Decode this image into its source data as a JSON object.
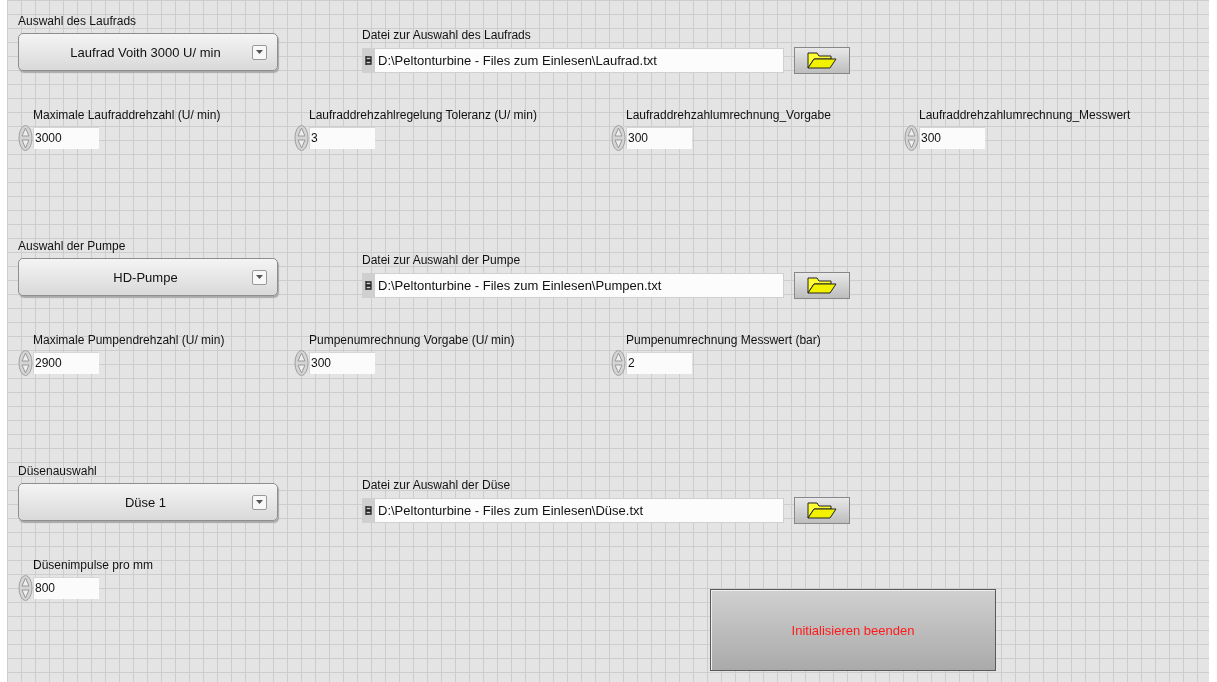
{
  "sections": [
    {
      "selector": {
        "label": "Auswahl des Laufrads",
        "value": "Laufrad Voith 3000 U/ min"
      },
      "file": {
        "label": "Datei zur Auswahl des Laufrads",
        "path": "D:\\Peltonturbine - Files zum Einlesen\\Laufrad.txt"
      },
      "numerics": [
        {
          "label": "Maximale Laufraddrehzahl (U/ min)",
          "value": "3000"
        },
        {
          "label": "Laufraddrehzahlregelung Toleranz (U/ min)",
          "value": "3"
        },
        {
          "label": "Laufraddrehzahlumrechnung_Vorgabe",
          "value": "300"
        },
        {
          "label": "Laufraddrehzahlumrechnung_Messwert",
          "value": "300"
        }
      ]
    },
    {
      "selector": {
        "label": "Auswahl der Pumpe",
        "value": "HD-Pumpe"
      },
      "file": {
        "label": "Datei zur Auswahl der Pumpe",
        "path": "D:\\Peltonturbine - Files zum Einlesen\\Pumpen.txt"
      },
      "numerics": [
        {
          "label": "Maximale Pumpendrehzahl (U/ min)",
          "value": "2900"
        },
        {
          "label": "Pumpenumrechnung Vorgabe (U/ min)",
          "value": "300"
        },
        {
          "label": "Pumpenumrechnung Messwert (bar)",
          "value": "2"
        }
      ]
    },
    {
      "selector": {
        "label": "Düsenauswahl",
        "value": "Düse 1"
      },
      "file": {
        "label": "Datei zur Auswahl der Düse",
        "path": "D:\\Peltonturbine - Files zum Einlesen\\Düse.txt"
      },
      "numerics": [
        {
          "label": "Düsenimpulse pro mm",
          "value": "800"
        }
      ]
    }
  ],
  "button": {
    "label": "Initialisieren beenden"
  }
}
